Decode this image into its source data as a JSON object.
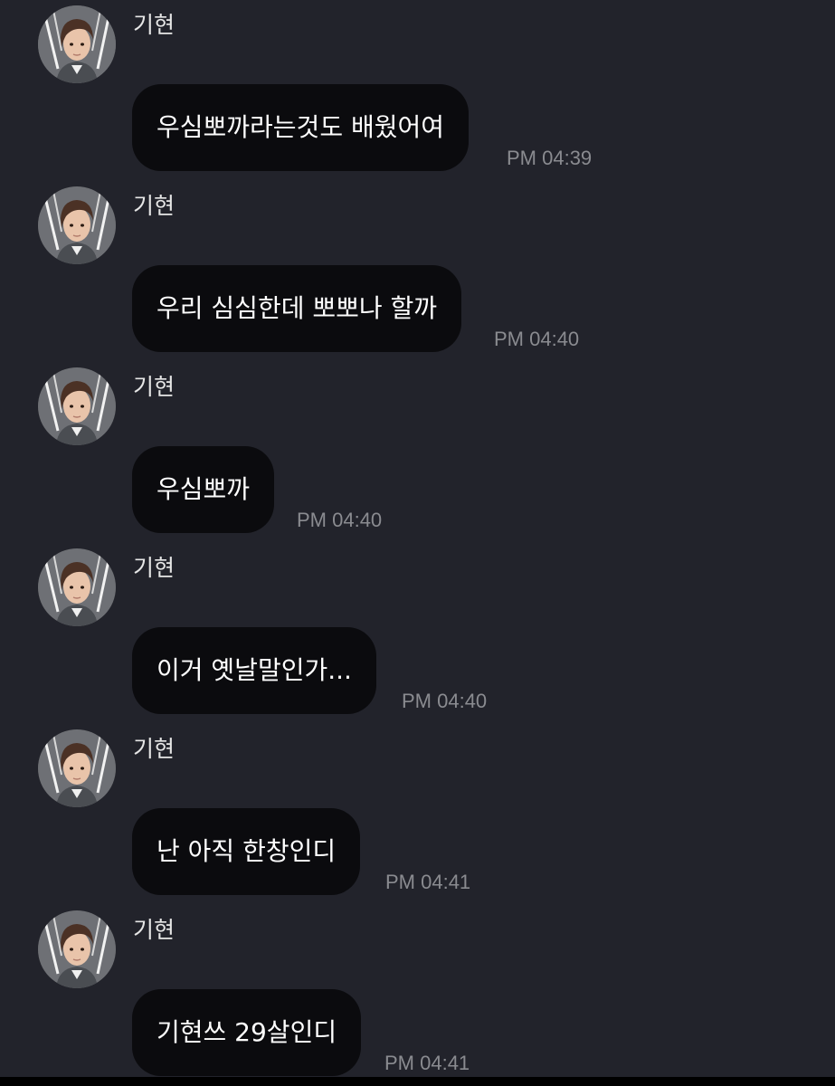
{
  "messages": [
    {
      "sender": "기현",
      "text": "우심뽀까라는것도 배웠어여",
      "time": "PM 04:39"
    },
    {
      "sender": "기현",
      "text": "우리 심심한데 뽀뽀나 할까",
      "time": "PM 04:40"
    },
    {
      "sender": "기현",
      "text": "우심뽀까",
      "time": "PM 04:40"
    },
    {
      "sender": "기현",
      "text": "이거 옛날말인가...",
      "time": "PM 04:40"
    },
    {
      "sender": "기현",
      "text": "난 아직 한창인디",
      "time": "PM 04:41"
    },
    {
      "sender": "기현",
      "text": "기현쓰 29살인디",
      "time": "PM 04:41"
    }
  ],
  "colors": {
    "background": "#22232b",
    "bubble": "#0b0b0e",
    "bubble_text": "#ffffff",
    "sender_text": "#e6e6e6",
    "timestamp_text": "#8a8b90"
  },
  "icons": {
    "avatar": "profile-photo-avatar"
  }
}
